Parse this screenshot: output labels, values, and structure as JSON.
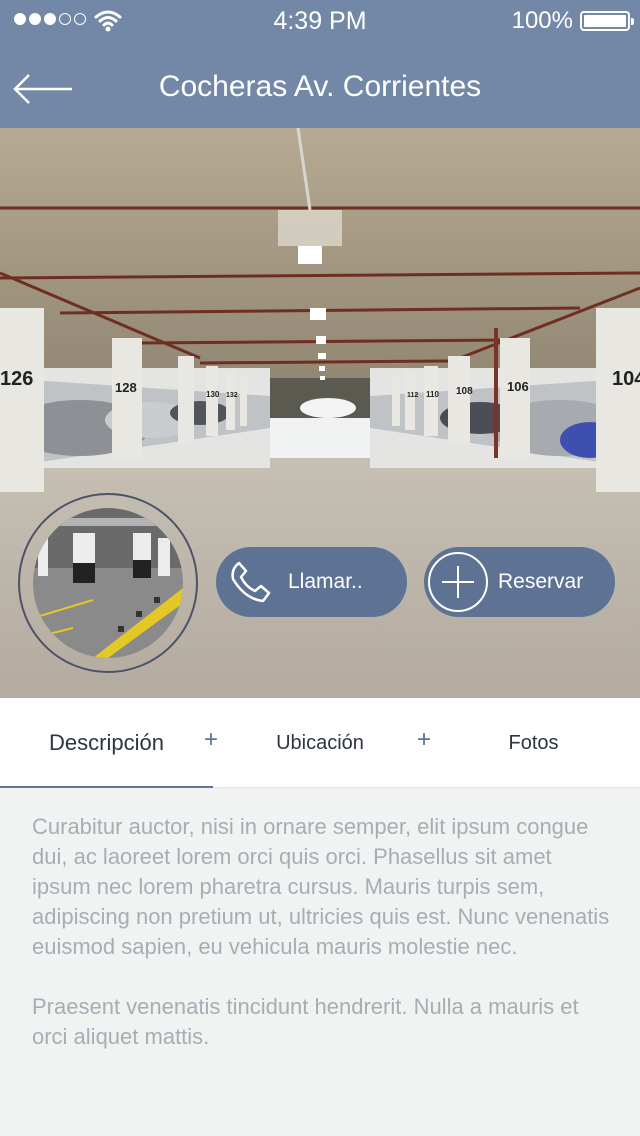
{
  "status_bar": {
    "time": "4:39 PM",
    "battery": "100%",
    "signal_bars": 3,
    "signal_total": 5
  },
  "header": {
    "title": "Cocheras Av. Corrientes",
    "back_icon": "back-arrow-icon"
  },
  "hero": {
    "image": "parking-garage-photo",
    "thumbnail": "parking-thumbnail",
    "pillar_numbers": [
      "126",
      "128",
      "130",
      "132",
      "112",
      "110",
      "108",
      "106",
      "104"
    ]
  },
  "actions": {
    "call_label": "Llamar..",
    "call_icon": "phone-icon",
    "reserve_label": "Reservar",
    "reserve_icon": "plus-circle-icon"
  },
  "tabs": [
    {
      "label": "Descripción",
      "active": true
    },
    {
      "label": "Ubicación",
      "active": false
    },
    {
      "label": "Fotos",
      "active": false
    }
  ],
  "tab_separator": "+",
  "description": {
    "paragraph_1": "Curabitur auctor, nisi in ornare semper, elit ipsum congue dui, ac laoreet lorem orci quis orci. Phasellus sit amet ipsum nec lorem pharetra cursus. Mauris turpis sem, adipiscing non pretium ut, ultricies quis est. Nunc venenatis euismod sapien, eu vehicula mauris molestie nec.",
    "paragraph_2": "Praesent venenatis tincidunt hendrerit. Nulla a mauris et orci aliquet mattis."
  },
  "colors": {
    "header": "#7388a6",
    "accent": "#5e7293",
    "body_bg": "#f1f2f2",
    "desc_text": "#a8adb5"
  }
}
